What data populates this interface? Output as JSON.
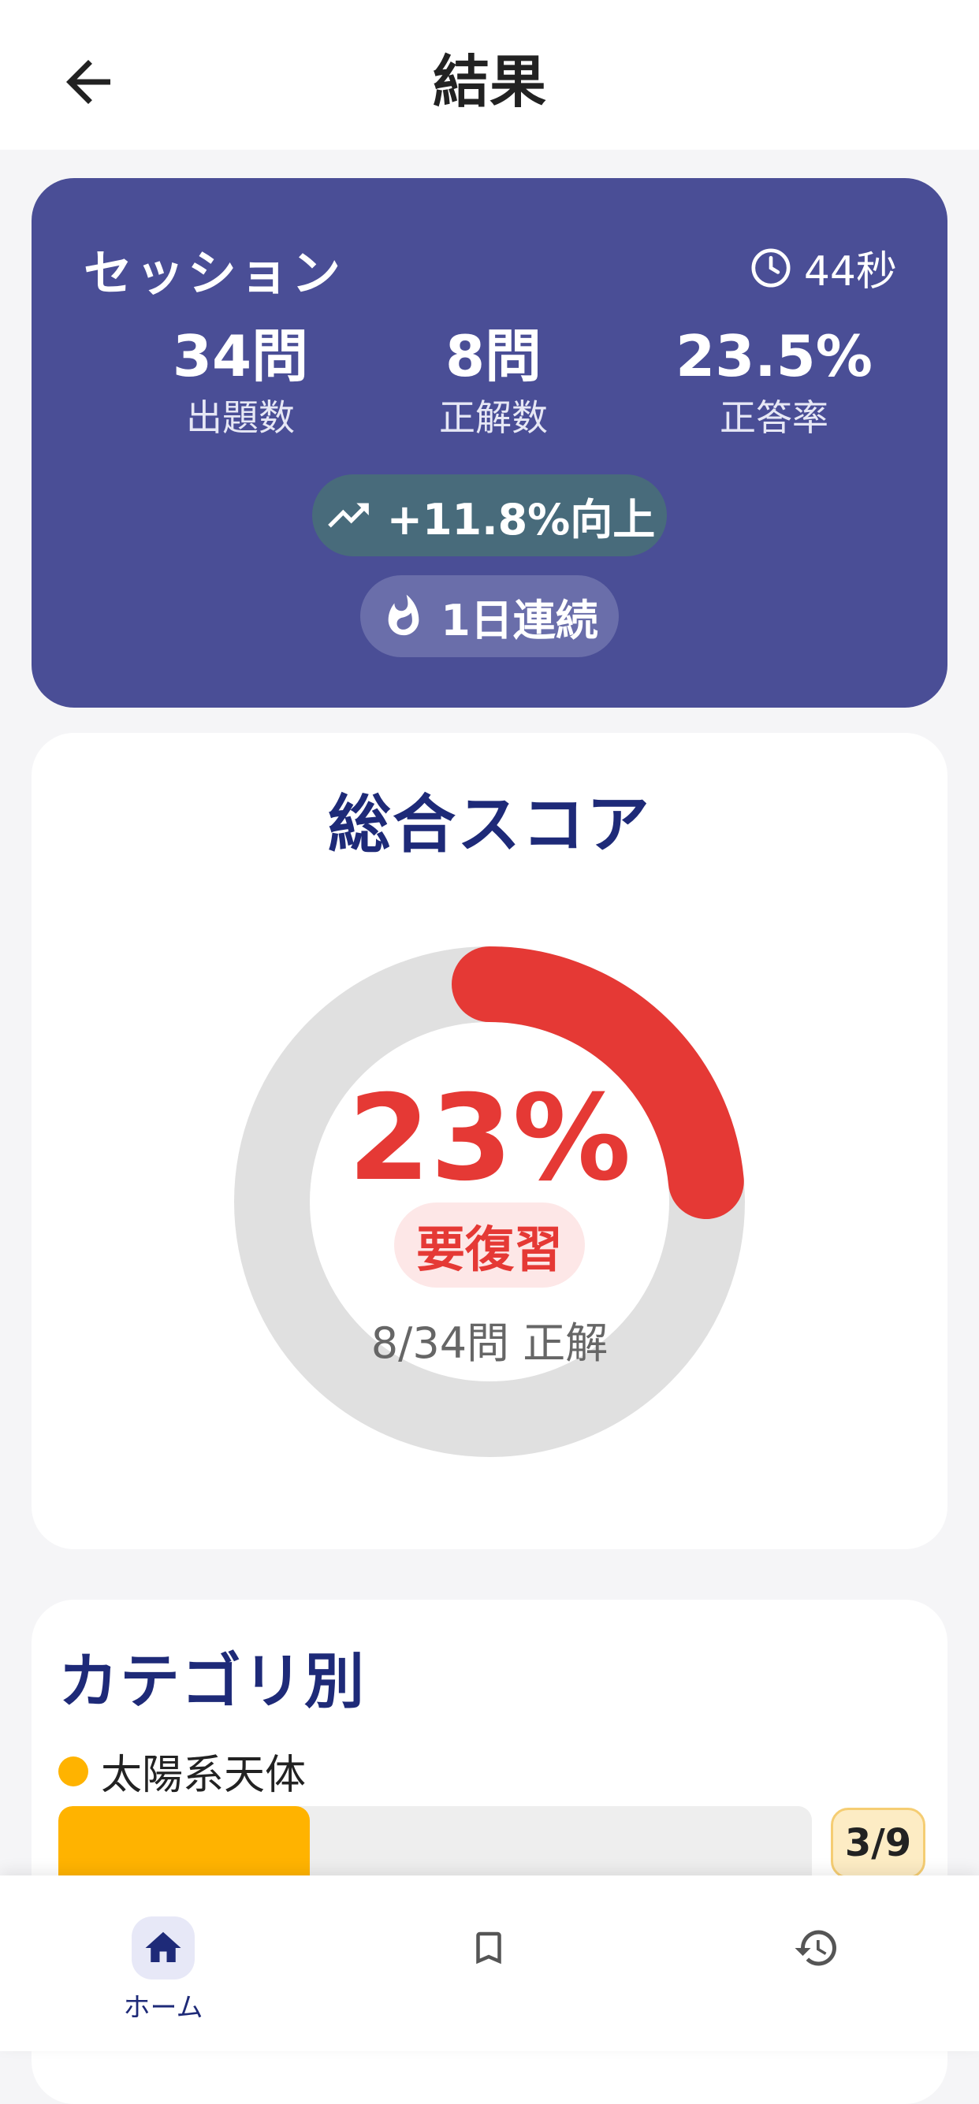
{
  "appbar": {
    "title": "結果"
  },
  "session": {
    "title": "セッション",
    "time": "44秒",
    "stats": [
      {
        "value": "34問",
        "label": "出題数"
      },
      {
        "value": "8問",
        "label": "正解数"
      },
      {
        "value": "23.5%",
        "label": "正答率"
      }
    ],
    "improvement": "+11.8%向上",
    "streak": "1日連続"
  },
  "score": {
    "title": "総合スコア",
    "percent_text": "23%",
    "percent": 23.5,
    "status": "要復習",
    "detail": "8/34問 正解"
  },
  "categories": {
    "title": "カテゴリ別",
    "items": [
      {
        "name": "太陽系天体",
        "correct": 3,
        "total": 9,
        "count_label": "3/9",
        "color": "#ffb300"
      }
    ]
  },
  "nav": {
    "items": [
      {
        "label": "ホーム",
        "icon": "home-icon",
        "active": true
      },
      {
        "label": "",
        "icon": "bookmark-icon",
        "active": false
      },
      {
        "label": "",
        "icon": "history-icon",
        "active": false
      }
    ]
  },
  "colors": {
    "primary": "#4a4e96",
    "accent_red": "#e53935",
    "accent_amber": "#ffb300",
    "title_navy": "#1e2a78"
  }
}
